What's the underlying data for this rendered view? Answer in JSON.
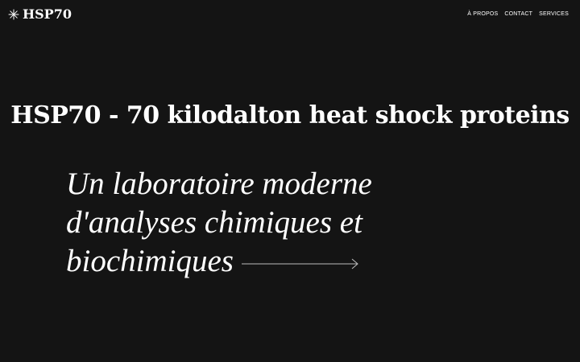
{
  "header": {
    "brand": {
      "icon": "asterisk-star-icon",
      "name": "HSP70"
    },
    "nav": [
      {
        "label": "À PROPOS"
      },
      {
        "label": "CONTACT"
      },
      {
        "label": "SERVICES"
      }
    ]
  },
  "hero": {
    "headline": "HSP70 - 70 kilodalton heat shock proteins",
    "tagline": "Un laboratoire moderne d'analyses chimiques et biochimiques",
    "arrow_icon": "long-arrow-right-icon"
  },
  "colors": {
    "background": "#141414",
    "text": "#ffffff",
    "arrow": "#bdbdbd"
  }
}
